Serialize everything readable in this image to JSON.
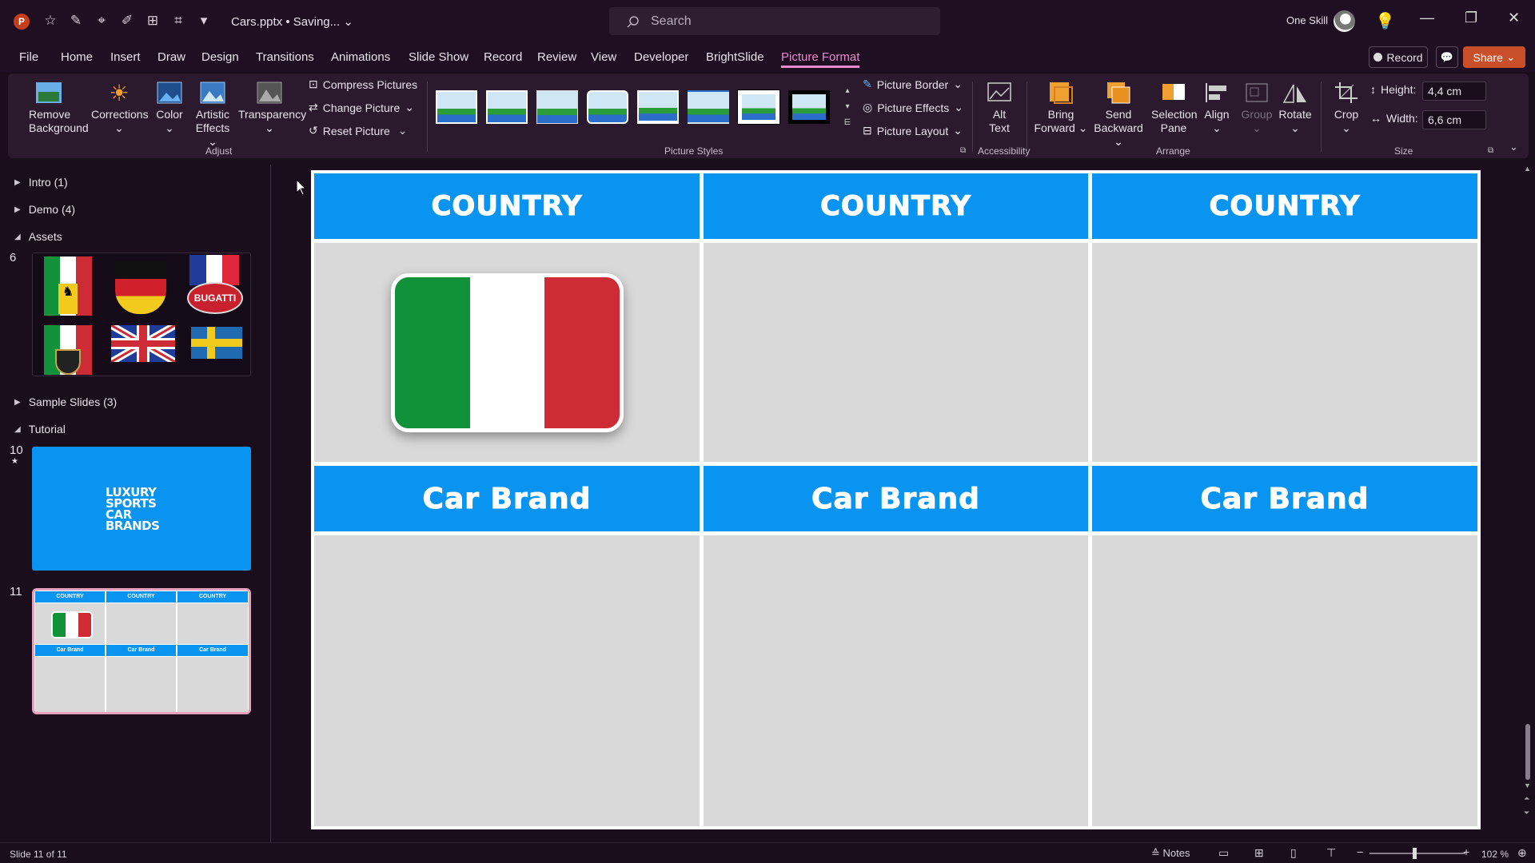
{
  "titlebar": {
    "filename": "Cars.pptx • Saving...",
    "search_placeholder": "Search",
    "user": "One Skill"
  },
  "menu": {
    "file": "File",
    "home": "Home",
    "insert": "Insert",
    "draw": "Draw",
    "design": "Design",
    "transitions": "Transitions",
    "animations": "Animations",
    "slideshow": "Slide Show",
    "record": "Record",
    "review": "Review",
    "view": "View",
    "developer": "Developer",
    "brightslide": "BrightSlide",
    "picture_format": "Picture Format"
  },
  "actions": {
    "record": "Record",
    "share": "Share"
  },
  "ribbon": {
    "remove_bg_1": "Remove",
    "remove_bg_2": "Background",
    "corrections": "Corrections",
    "color": "Color",
    "artistic_1": "Artistic",
    "artistic_2": "Effects",
    "transparency": "Transparency",
    "compress": "Compress Pictures",
    "change": "Change Picture",
    "reset": "Reset Picture",
    "adjust_label": "Adjust",
    "picture_styles_label": "Picture Styles",
    "picture_border": "Picture Border",
    "picture_effects": "Picture Effects",
    "picture_layout": "Picture Layout",
    "alt_1": "Alt",
    "alt_2": "Text",
    "accessibility_label": "Accessibility",
    "bring_1": "Bring",
    "bring_2": "Forward",
    "send_1": "Send",
    "send_2": "Backward",
    "selection_1": "Selection",
    "selection_2": "Pane",
    "align": "Align",
    "group": "Group",
    "rotate": "Rotate",
    "arrange_label": "Arrange",
    "crop": "Crop",
    "height_label": "Height:",
    "height_value": "4,4 cm",
    "width_label": "Width:",
    "width_value": "6,6 cm",
    "size_label": "Size"
  },
  "sections": {
    "intro": "Intro (1)",
    "demo": "Demo (4)",
    "assets": "Assets",
    "sample": "Sample Slides (3)",
    "tutorial": "Tutorial"
  },
  "slides": {
    "n6": "6",
    "n10": "10",
    "n11": "11",
    "title_slide_text": "LUXURY SPORTS CAR BRANDS",
    "mini_country": "COUNTRY",
    "mini_brand": "Car Brand",
    "bugatti": "BUGATTI"
  },
  "slide": {
    "country": "COUNTRY",
    "brand": "Car Brand"
  },
  "status": {
    "slide_info": "Slide 11 of 11",
    "notes": "Notes",
    "zoom": "102 %"
  },
  "colors": {
    "accent": "#0a94f2",
    "active_tab": "#e88acc",
    "share": "#c94f2a",
    "italy_green": "#10913a",
    "italy_red": "#cd2b36"
  }
}
